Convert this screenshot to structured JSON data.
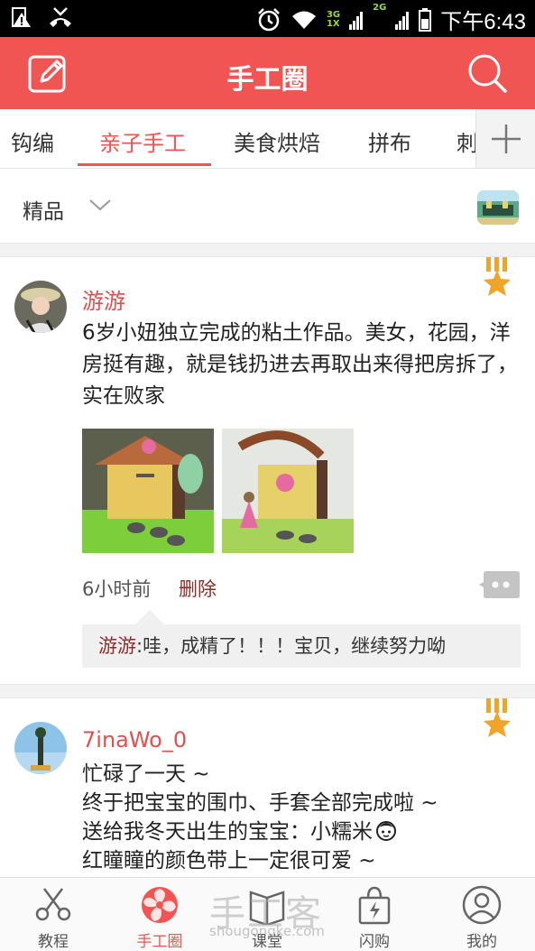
{
  "status_bar": {
    "network1": "3G",
    "network1b": "1X",
    "network2": "2G",
    "time": "下午6:43"
  },
  "header": {
    "title": "手工圈",
    "edit_icon": "edit-icon",
    "search_icon": "search-icon"
  },
  "tabs": [
    {
      "label": "钩编"
    },
    {
      "label": "亲子手工"
    },
    {
      "label": "美食烘焙"
    },
    {
      "label": "拼布"
    },
    {
      "label": "刺"
    }
  ],
  "filter": {
    "label": "精品"
  },
  "posts": [
    {
      "username": "游游",
      "content": "6岁小妞独立完成的粘土作品。美女，花园，洋房挺有趣，就是钱扔进去再取出来得把房拆了，实在败家",
      "time": "6小时前",
      "delete": "删除",
      "comment": {
        "name": "游游",
        "text": ":哇，成精了！！！宝贝，继续努力呦"
      }
    },
    {
      "username": "7inaWo_0",
      "lines": [
        "忙碌了一天 ~",
        "终于把宝宝的围巾、手套全部完成啦 ~",
        "送给我冬天出生的宝宝：小糯米",
        "红瞳瞳的颜色带上一定很可爱 ~"
      ]
    }
  ],
  "bottom_nav": [
    {
      "label": "教程",
      "icon": "scissors-icon"
    },
    {
      "label": "手工圈",
      "icon": "flower-icon"
    },
    {
      "label": "课堂",
      "icon": "book-icon"
    },
    {
      "label": "闪购",
      "icon": "shopping-bag-icon"
    },
    {
      "label": "我的",
      "icon": "profile-icon"
    }
  ],
  "watermark": {
    "brand": "手工客",
    "url": "shougongke.com"
  },
  "colors": {
    "accent": "#f05553",
    "username": "#e0504e",
    "dark_red": "#8e2c2a"
  }
}
